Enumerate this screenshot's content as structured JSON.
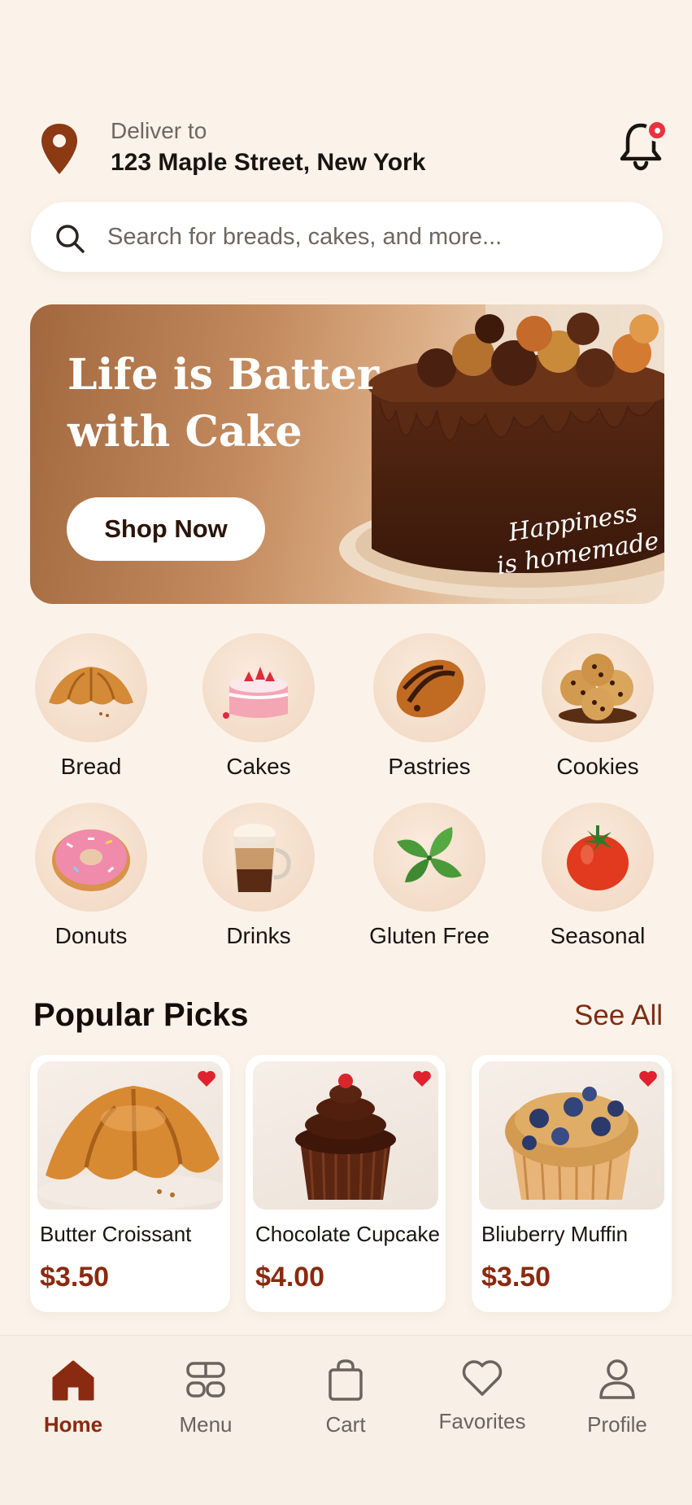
{
  "header": {
    "deliver_label": "Deliver to",
    "address": "123 Maple Street, New York",
    "location_icon": "map-pin-icon",
    "notification_icon": "bell-icon"
  },
  "search": {
    "placeholder": "Search for breads, cakes, and more...",
    "value": ""
  },
  "banner": {
    "title": "Life is Batter with Cake",
    "button_label": "Shop Now",
    "tagline_line1": "Happiness",
    "tagline_line2": "is homemade"
  },
  "categories": [
    {
      "label": "Bread",
      "icon": "croissant-icon"
    },
    {
      "label": "Cakes",
      "icon": "cake-icon"
    },
    {
      "label": "Pastries",
      "icon": "pastry-icon"
    },
    {
      "label": "Cookies",
      "icon": "cookie-icon"
    },
    {
      "label": "Donuts",
      "icon": "donut-icon"
    },
    {
      "label": "Drinks",
      "icon": "coffee-icon"
    },
    {
      "label": "Gluten Free",
      "icon": "leaf-icon"
    },
    {
      "label": "Seasonal",
      "icon": "tomato-icon"
    }
  ],
  "popular": {
    "title": "Popular Picks",
    "see_all": "See All",
    "items": [
      {
        "name": "Butter Croissant",
        "price": "$3.50",
        "favorite": true
      },
      {
        "name": "Chocolate Cupcake",
        "price": "$4.00",
        "favorite": true
      },
      {
        "name": "Bliuberry Muffin",
        "price": "$3.50",
        "favorite": true
      }
    ]
  },
  "nav": {
    "items": [
      {
        "label": "Home",
        "icon": "home-icon",
        "active": true
      },
      {
        "label": "Menu",
        "icon": "grid-icon",
        "active": false
      },
      {
        "label": "Cart",
        "icon": "shopping-bag-icon",
        "active": false
      },
      {
        "label": "Favorites",
        "icon": "heart-icon",
        "active": false
      },
      {
        "label": "Profile",
        "icon": "user-icon",
        "active": false
      }
    ]
  },
  "colors": {
    "background": "#fbf3ea",
    "accent": "#8a2a10",
    "notification": "#e8323c",
    "heart": "#e0222f"
  }
}
